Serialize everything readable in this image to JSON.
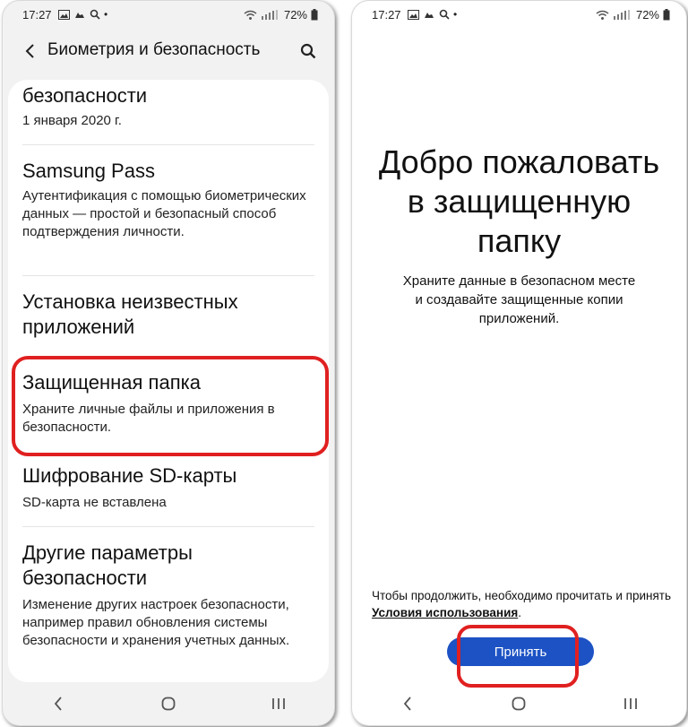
{
  "left_screen": {
    "status_bar": {
      "time": "17:27",
      "battery": "72%"
    },
    "header": {
      "title": "Биометрия и безопасность"
    },
    "items": [
      {
        "title": "безопасности",
        "subtitle": "1 января 2020 г."
      },
      {
        "title": "Samsung Pass",
        "subtitle": "Аутентификация с помощью биометрических данных — простой и безопасный способ подтверждения личности."
      },
      {
        "title": "Установка неизвестных приложений",
        "subtitle": ""
      },
      {
        "title": "Защищенная папка",
        "subtitle": "Храните личные файлы и приложения в безопасности."
      },
      {
        "title": "Шифрование SD-карты",
        "subtitle": "SD-карта не вставлена"
      },
      {
        "title": "Другие параметры безопасности",
        "subtitle": "Изменение других настроек безопасности, например правил обновления системы безопасности и хранения учетных данных."
      }
    ]
  },
  "right_screen": {
    "status_bar": {
      "time": "17:27",
      "battery": "72%"
    },
    "title": "Добро пожаловать\nв защищенную\nпапку",
    "description": "Храните данные в безопасном месте\nи создавайте защищенные копии\nприложений.",
    "terms_prefix": "Чтобы продолжить, необходимо прочитать и принять ",
    "terms_link": "Условия использования",
    "terms_suffix": ".",
    "accept_label": "Принять"
  },
  "colors": {
    "highlight": "#e02020",
    "accept_button": "#1c52c4",
    "settings_background": "#f2f2f2"
  },
  "icons": [
    "back-arrow-icon",
    "search-icon",
    "wifi-icon",
    "signal-icon",
    "battery-icon",
    "recent-apps-icon",
    "home-icon",
    "nav-back-icon"
  ]
}
